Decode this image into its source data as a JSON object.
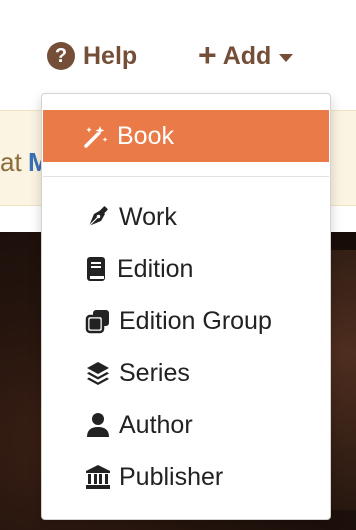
{
  "navbar": {
    "help_label": "Help",
    "add_label": "Add"
  },
  "notice": {
    "text_start": "at",
    "link_text": "M"
  },
  "dropdown": {
    "items": [
      {
        "label": "Book",
        "icon": "magic-wand-icon",
        "active": true
      },
      {
        "label": "Work",
        "icon": "pen-nib-icon"
      },
      {
        "label": "Edition",
        "icon": "book-icon"
      },
      {
        "label": "Edition Group",
        "icon": "clone-icon"
      },
      {
        "label": "Series",
        "icon": "layer-group-icon"
      },
      {
        "label": "Author",
        "icon": "user-icon"
      },
      {
        "label": "Publisher",
        "icon": "university-icon"
      }
    ]
  },
  "colors": {
    "brand_brown": "#754e37",
    "active_orange": "#ea7a47",
    "notice_bg": "#fcf4e2",
    "link_blue": "#3b6fb6"
  }
}
